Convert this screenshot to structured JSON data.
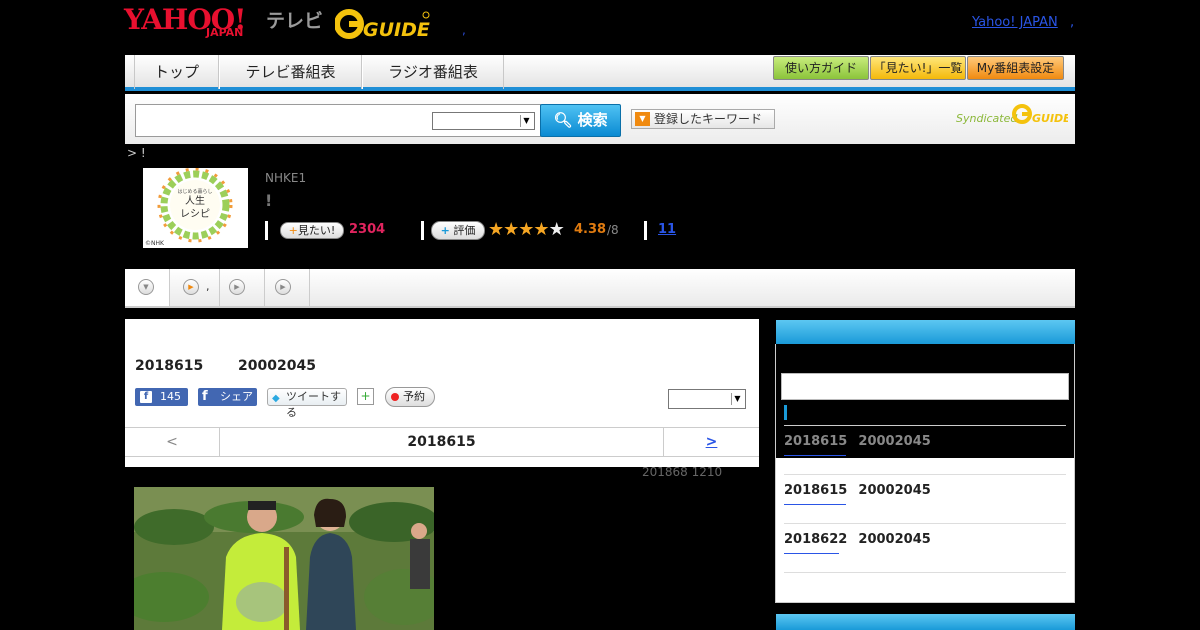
{
  "header": {
    "logo_yahoo": "YAHOO!",
    "logo_japan": "JAPAN",
    "logo_tv": "テレビ",
    "logo_gguide": "G GUIDE",
    "gguide_dot": ",",
    "yahoo_japan_link": "Yahoo! JAPAN",
    "link_comma": ","
  },
  "nav": {
    "tabs": [
      "トップ",
      "テレビ番組表",
      "ラジオ番組表"
    ],
    "guide_button": "使い方ガイド",
    "mitai_list_button": "「見たい!」一覧",
    "my_schedule_button": "My番組表設定"
  },
  "search": {
    "input_value": "",
    "select_value": "",
    "button_label": "検索",
    "keyword_button": "登録したキーワード",
    "syndicated": "Syndicated",
    "syndicated_logo": "G GUIDE"
  },
  "breadcrumb": "> !",
  "program": {
    "thumb_title_top": "はじめる暮らし",
    "thumb_title": "人生レシピ",
    "thumb_credit": "©NHK",
    "channel": "NHKE1",
    "title": "!",
    "mitai_label": "見たい!",
    "mitai_count": "2304",
    "rate_label": "評価",
    "rating": 4.38,
    "rating_value": "4.38",
    "rating_max": "/8",
    "review_count": "11"
  },
  "subtabs": [
    {
      "label": ""
    },
    {
      "label": ","
    },
    {
      "label": ""
    },
    {
      "label": ""
    }
  ],
  "broadcast": {
    "date": "2018615",
    "time": "20002045",
    "fb_like_count": "145",
    "fb_share": "シェア",
    "tweet": "ツイートする",
    "reserve": "予約",
    "share_select_value": "",
    "pager_prev": "<",
    "pager_date": "2018615",
    "pager_next": ">",
    "updated": "201868  1210"
  },
  "sidebar": {
    "input_value": "",
    "episodes": [
      {
        "date": "2018615",
        "time": "20002045"
      },
      {
        "date": "2018615",
        "time": "20002045"
      },
      {
        "date": "2018622",
        "time": "20002045"
      }
    ]
  },
  "colors": {
    "brand_red": "#e8102f",
    "accent_blue": "#1a9ad8",
    "link_blue": "#2a55e6",
    "mitai_pink": "#e0245e",
    "star_gold": "#f6a623"
  }
}
